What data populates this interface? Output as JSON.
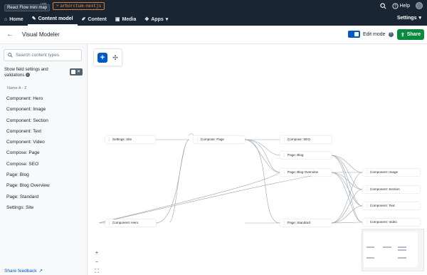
{
  "topbar": {
    "tooltip": "React Flow mini map",
    "env_name": "um",
    "branch": "arborctum-nextjs",
    "help_label": "Help",
    "settings_label": "Settings"
  },
  "nav": {
    "items": [
      {
        "label": "Home",
        "icon": "home-icon"
      },
      {
        "label": "Content model",
        "icon": "wrench-icon"
      },
      {
        "label": "Content",
        "icon": "pen-icon"
      },
      {
        "label": "Media",
        "icon": "image-icon"
      },
      {
        "label": "Apps",
        "icon": "puzzle-icon"
      }
    ]
  },
  "subheader": {
    "title": "Visual Modeler",
    "edit_mode_label": "Edit mode",
    "share_label": "Share"
  },
  "sidebar": {
    "search_placeholder": "Search content types",
    "field_settings_label": "Show field settings and validations",
    "sort_label": "Name A - Z",
    "content_types": [
      "Component: Hero",
      "Component: Image",
      "Component: Section",
      "Component: Text",
      "Component: Video",
      "Compose: Page",
      "Compose: SEO",
      "Page: Blog",
      "Page: Blog Overview",
      "Page: Standard",
      "Settings: Site"
    ],
    "feedback_label": "Share feedback"
  },
  "canvas": {
    "nodes": [
      {
        "label": "Settings: Site"
      },
      {
        "label": "Compose: Page"
      },
      {
        "label": "Compose: SEO"
      },
      {
        "label": "Page: Blog"
      },
      {
        "label": "Page: Blog Overview"
      },
      {
        "label": "Component: Hero"
      },
      {
        "label": "Page: Standard"
      },
      {
        "label": "Component: Image"
      },
      {
        "label": "Component: Section"
      },
      {
        "label": "Component: Text"
      },
      {
        "label": "Component: Video"
      }
    ],
    "zoom_in": "+",
    "zoom_out": "−",
    "fit": "⛶"
  },
  "colors": {
    "topbar": "#192532",
    "accent": "#0059c8",
    "share": "#0a8a3f",
    "branch": "#f08d3b"
  }
}
